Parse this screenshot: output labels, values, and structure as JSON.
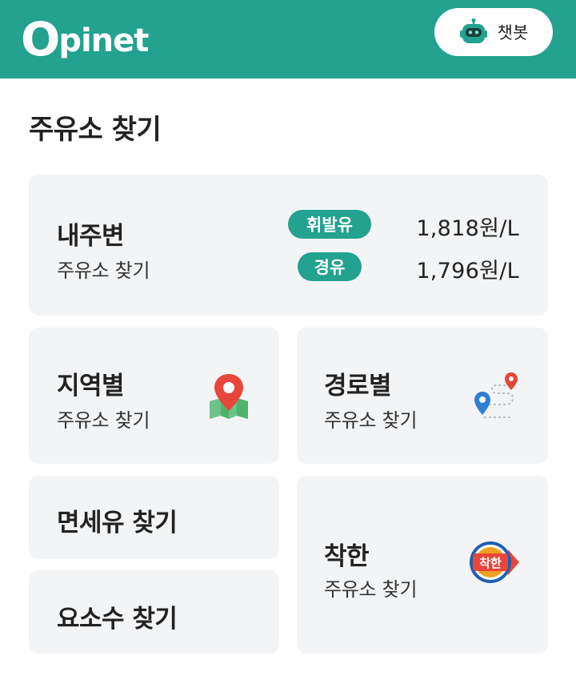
{
  "header": {
    "logo_o": "O",
    "logo_rest": "pinet",
    "chatbot_label": "챗봇",
    "background": "#22a28f"
  },
  "section_title": "주유소 찾기",
  "cards": {
    "nearby": {
      "title": "내주변",
      "subtitle": "주유소 찾기",
      "prices": [
        {
          "fuel": "휘발유",
          "price": "1,818원/L"
        },
        {
          "fuel": "경유",
          "price": "1,796원/L"
        }
      ]
    },
    "region": {
      "title": "지역별",
      "subtitle": "주유소 찾기",
      "icon": "map-pin-icon"
    },
    "route": {
      "title": "경로별",
      "subtitle": "주유소 찾기",
      "icon": "route-icon"
    },
    "dutyfree": {
      "title": "면세유 찾기"
    },
    "urea": {
      "title": "요소수 찾기"
    },
    "good": {
      "title": "착한",
      "subtitle": "주유소 찾기",
      "badge_text": "착한",
      "icon": "good-station-badge-icon"
    }
  },
  "colors": {
    "accent": "#22a28f",
    "card_bg": "#f3f4f6",
    "pin_red": "#e8463a",
    "map_green": "#4fb36b",
    "route_blue": "#2f7fd9"
  }
}
